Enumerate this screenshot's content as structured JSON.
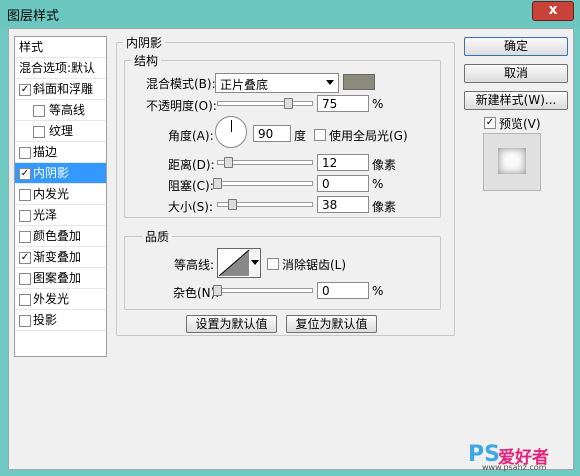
{
  "window": {
    "title": "图层样式",
    "close": "x"
  },
  "style_list": {
    "items": [
      {
        "label": "样式",
        "checked": null,
        "indent": false
      },
      {
        "label": "混合选项:默认",
        "checked": null,
        "indent": false
      },
      {
        "label": "斜面和浮雕",
        "checked": true,
        "indent": false
      },
      {
        "label": "等高线",
        "checked": false,
        "indent": true
      },
      {
        "label": "纹理",
        "checked": false,
        "indent": true
      },
      {
        "label": "描边",
        "checked": false,
        "indent": false
      },
      {
        "label": "内阴影",
        "checked": true,
        "indent": false,
        "selected": true
      },
      {
        "label": "内发光",
        "checked": false,
        "indent": false
      },
      {
        "label": "光泽",
        "checked": false,
        "indent": false
      },
      {
        "label": "颜色叠加",
        "checked": false,
        "indent": false
      },
      {
        "label": "渐变叠加",
        "checked": true,
        "indent": false
      },
      {
        "label": "图案叠加",
        "checked": false,
        "indent": false
      },
      {
        "label": "外发光",
        "checked": false,
        "indent": false
      },
      {
        "label": "投影",
        "checked": false,
        "indent": false
      }
    ]
  },
  "panel": {
    "title": "内阴影",
    "structure": {
      "title": "结构",
      "blend_mode_label": "混合模式(B):",
      "blend_mode_value": "正片叠底",
      "shadow_color": "#8b8b7b",
      "opacity_label": "不透明度(O):",
      "opacity_value": "75",
      "opacity_unit": "%",
      "opacity_fraction": 0.75,
      "angle_label": "角度(A):",
      "angle_value": "90",
      "angle_unit": "度",
      "global_light_label": "使用全局光(G)",
      "global_light_checked": false,
      "distance_label": "距离(D):",
      "distance_value": "12",
      "distance_unit": "像素",
      "distance_fraction": 0.12,
      "choke_label": "阻塞(C):",
      "choke_value": "0",
      "choke_unit": "%",
      "choke_fraction": 0.0,
      "size_label": "大小(S):",
      "size_value": "38",
      "size_unit": "像素",
      "size_fraction": 0.16
    },
    "quality": {
      "title": "品质",
      "contour_label": "等高线:",
      "antialias_label": "消除锯齿(L)",
      "antialias_checked": false,
      "noise_label": "杂色(N):",
      "noise_value": "0",
      "noise_unit": "%",
      "noise_fraction": 0.0
    },
    "set_default_label": "设置为默认值",
    "reset_default_label": "复位为默认值"
  },
  "buttons": {
    "ok": "确定",
    "cancel": "取消",
    "new_style": "新建样式(W)...",
    "preview_label": "预览(V)",
    "preview_checked": true
  },
  "watermark": {
    "ps": "PS",
    "text": "爱好者",
    "url": "www.psahz.com"
  },
  "colors": {
    "selection": "#3399ff",
    "title_bar": "#6cc7c1"
  }
}
